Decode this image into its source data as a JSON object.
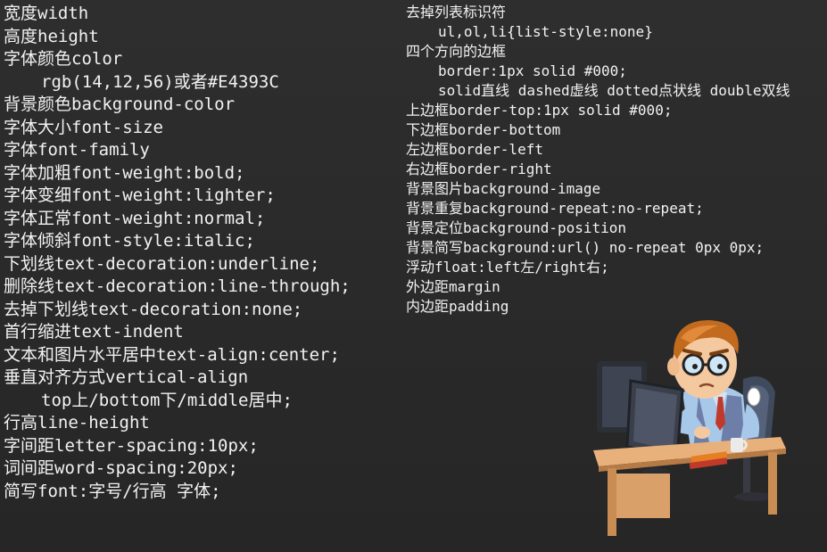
{
  "left_lines": [
    {
      "text": "宽度width",
      "indent": false
    },
    {
      "text": "高度height",
      "indent": false
    },
    {
      "text": "字体颜色color",
      "indent": false
    },
    {
      "text": "rgb(14,12,56)或者#E4393C",
      "indent": true
    },
    {
      "text": "背景颜色background-color",
      "indent": false
    },
    {
      "text": "字体大小font-size",
      "indent": false
    },
    {
      "text": "字体font-family",
      "indent": false
    },
    {
      "text": "字体加粗font-weight:bold;",
      "indent": false
    },
    {
      "text": "字体变细font-weight:lighter;",
      "indent": false
    },
    {
      "text": "字体正常font-weight:normal;",
      "indent": false
    },
    {
      "text": "字体倾斜font-style:italic;",
      "indent": false
    },
    {
      "text": "下划线text-decoration:underline;",
      "indent": false
    },
    {
      "text": "删除线text-decoration:line-through;",
      "indent": false
    },
    {
      "text": "去掉下划线text-decoration:none;",
      "indent": false
    },
    {
      "text": "首行缩进text-indent",
      "indent": false
    },
    {
      "text": "文本和图片水平居中text-align:center;",
      "indent": false
    },
    {
      "text": "垂直对齐方式vertical-align",
      "indent": false
    },
    {
      "text": "top上/bottom下/middle居中;",
      "indent": true
    },
    {
      "text": "行高line-height",
      "indent": false
    },
    {
      "text": "字间距letter-spacing:10px;",
      "indent": false
    },
    {
      "text": "词间距word-spacing:20px;",
      "indent": false
    },
    {
      "text": "简写font:字号/行高 字体;",
      "indent": false
    }
  ],
  "right_lines": [
    {
      "text": "去掉列表标识符",
      "indent": false
    },
    {
      "text": "ul,ol,li{list-style:none}",
      "indent": true
    },
    {
      "text": "四个方向的边框",
      "indent": false
    },
    {
      "text": "border:1px solid #000;",
      "indent": true
    },
    {
      "text": "solid直线 dashed虚线 dotted点状线 double双线",
      "indent": true
    },
    {
      "text": "上边框border-top:1px solid #000;",
      "indent": false
    },
    {
      "text": "下边框border-bottom",
      "indent": false
    },
    {
      "text": "左边框border-left",
      "indent": false
    },
    {
      "text": "右边框border-right",
      "indent": false
    },
    {
      "text": "背景图片background-image",
      "indent": false
    },
    {
      "text": "背景重复background-repeat:no-repeat;",
      "indent": false
    },
    {
      "text": "背景定位background-position",
      "indent": false
    },
    {
      "text": "背景简写background:url() no-repeat 0px 0px;",
      "indent": false
    },
    {
      "text": "浮动float:left左/right右;",
      "indent": false
    },
    {
      "text": "外边距margin",
      "indent": false
    },
    {
      "text": "内边距padding",
      "indent": false
    }
  ],
  "colors": {
    "background": "#2b2b2b",
    "text": "#f2f2f2",
    "desk": "#e8b07a",
    "shirt": "#a8c8ea",
    "hair": "#c26a1e"
  },
  "illustration": {
    "icon": "programmer-at-computer-icon"
  }
}
